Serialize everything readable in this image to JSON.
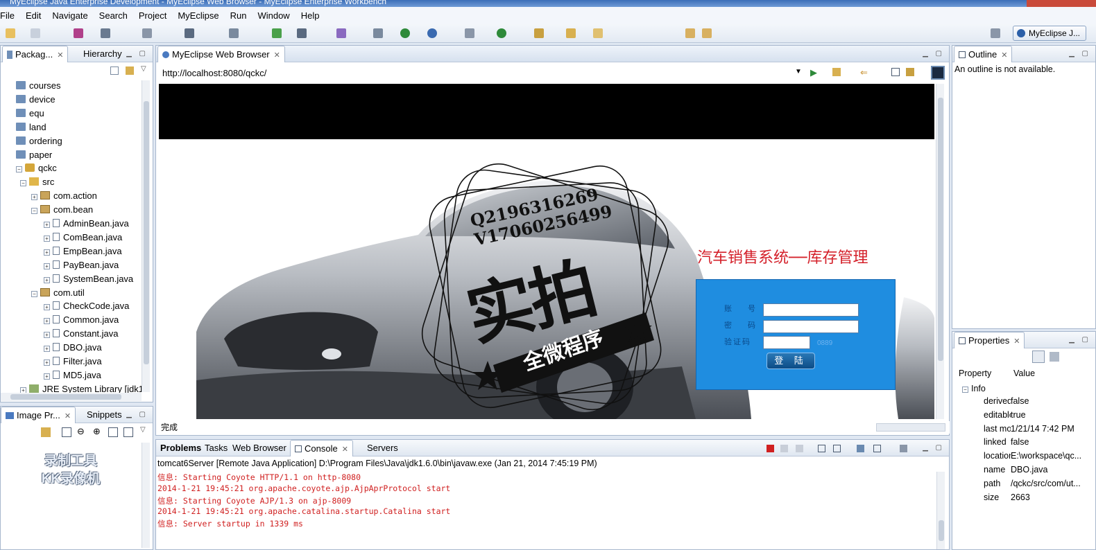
{
  "window": {
    "title": "MyEclipse Java Enterprise Development - MyEclipse Web Browser - MyEclipse Enterprise Workbench"
  },
  "menu": [
    "File",
    "Edit",
    "Navigate",
    "Search",
    "Project",
    "MyEclipse",
    "Run",
    "Window",
    "Help"
  ],
  "perspective_label": "MyEclipse J...",
  "left_top_tabs": {
    "package": "Packag...",
    "hierarchy": "Hierarchy"
  },
  "tree": [
    {
      "label": "courses",
      "type": "folder",
      "indent": 1
    },
    {
      "label": "device",
      "type": "folder",
      "indent": 1
    },
    {
      "label": "equ",
      "type": "folder",
      "indent": 1
    },
    {
      "label": "land",
      "type": "folder",
      "indent": 1
    },
    {
      "label": "ordering",
      "type": "folder",
      "indent": 1
    },
    {
      "label": "paper",
      "type": "folder",
      "indent": 1
    },
    {
      "label": "qckc",
      "type": "proj",
      "indent": 1
    },
    {
      "label": "src",
      "type": "src",
      "indent": 2
    },
    {
      "label": "com.action",
      "type": "pkg",
      "indent": 3
    },
    {
      "label": "com.bean",
      "type": "pkg",
      "indent": 3
    },
    {
      "label": "AdminBean.java",
      "type": "file",
      "indent": 4
    },
    {
      "label": "ComBean.java",
      "type": "file",
      "indent": 4
    },
    {
      "label": "EmpBean.java",
      "type": "file",
      "indent": 4
    },
    {
      "label": "PayBean.java",
      "type": "file",
      "indent": 4
    },
    {
      "label": "SystemBean.java",
      "type": "file",
      "indent": 4
    },
    {
      "label": "com.util",
      "type": "pkg",
      "indent": 3
    },
    {
      "label": "CheckCode.java",
      "type": "file",
      "indent": 4
    },
    {
      "label": "Common.java",
      "type": "file",
      "indent": 4
    },
    {
      "label": "Constant.java",
      "type": "file",
      "indent": 4
    },
    {
      "label": "DBO.java",
      "type": "file",
      "indent": 4
    },
    {
      "label": "Filter.java",
      "type": "file",
      "indent": 4
    },
    {
      "label": "MD5.java",
      "type": "file",
      "indent": 4
    },
    {
      "label": "JRE System Library [jdk1",
      "type": "lib",
      "indent": 2
    }
  ],
  "left_bottom_tabs": {
    "image": "Image Pr...",
    "snippets": "Snippets"
  },
  "watermark_kk": {
    "line1": "录制工具",
    "line2": "KK录像机"
  },
  "browser": {
    "tab": "MyEclipse Web Browser",
    "url": "http://localhost:8080/qckc/",
    "status": "完成"
  },
  "webpage": {
    "login_title": "汽车销售系统──库存管理",
    "label_account": "账 号",
    "label_password": "密 码",
    "label_code": "验证码",
    "code_image": "0889",
    "login_button": "登 陆"
  },
  "stamp": {
    "line1": "Q2196316269",
    "line2": "V17060256499",
    "big": "实拍",
    "ribbon": "全微程序"
  },
  "outline": {
    "tab": "Outline",
    "message": "An outline is not available."
  },
  "properties": {
    "tab": "Properties",
    "col_property": "Property",
    "col_value": "Value",
    "group": "Info",
    "rows": [
      {
        "k": "derived",
        "v": "false"
      },
      {
        "k": "editable",
        "v": "true"
      },
      {
        "k": "last modified",
        "v": "1/21/14 7:42 PM"
      },
      {
        "k": "linked",
        "v": "false"
      },
      {
        "k": "location",
        "v": "E:\\workspace\\qc..."
      },
      {
        "k": "name",
        "v": "DBO.java"
      },
      {
        "k": "path",
        "v": "/qckc/src/com/ut..."
      },
      {
        "k": "size",
        "v": "2663"
      }
    ]
  },
  "bottom_tabs": [
    "Problems",
    "Tasks",
    "Web Browser",
    "Console",
    "Servers"
  ],
  "console": {
    "header": "tomcat6Server [Remote Java Application] D:\\Program Files\\Java\\jdk1.6.0\\bin\\javaw.exe (Jan 21, 2014 7:45:19 PM)",
    "lines": [
      "信息: Starting Coyote HTTP/1.1 on http-8080",
      "2014-1-21 19:45:21 org.apache.coyote.ajp.AjpAprProtocol start",
      "信息: Starting Coyote AJP/1.3 on ajp-8009",
      "2014-1-21 19:45:21 org.apache.catalina.startup.Catalina start",
      "信息: Server startup in 1339 ms"
    ]
  }
}
